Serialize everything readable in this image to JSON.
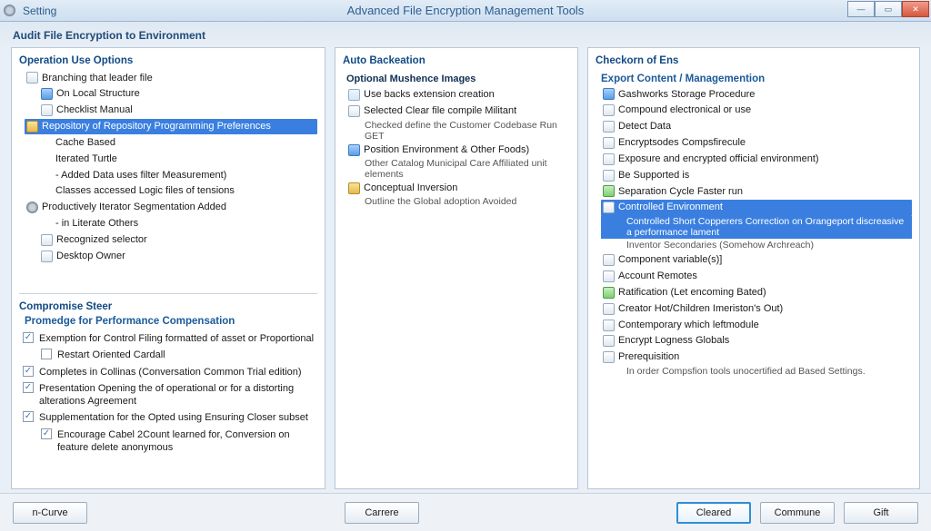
{
  "window": {
    "app_label": "Setting",
    "title": "Advanced File Encryption Management Tools"
  },
  "subheader": "Audit File Encryption to Environment",
  "left": {
    "upper_title": "Operation Use Options",
    "tree": [
      {
        "icon": "page",
        "indent": 0,
        "selected": false,
        "text": "Branching that leader file"
      },
      {
        "icon": "blue",
        "indent": 1,
        "selected": false,
        "text": "On Local Structure"
      },
      {
        "icon": "page",
        "indent": 1,
        "selected": false,
        "text": "Checklist Manual"
      },
      {
        "icon": "folder",
        "indent": 0,
        "selected": true,
        "text": "Repository of Repository Programming Preferences"
      },
      {
        "icon": "",
        "indent": 2,
        "selected": false,
        "text": "Cache Based"
      },
      {
        "icon": "",
        "indent": 2,
        "selected": false,
        "text": "Iterated Turtle"
      },
      {
        "icon": "",
        "indent": 2,
        "selected": false,
        "text": "- Added Data uses filter Measurement)"
      },
      {
        "icon": "",
        "indent": 2,
        "selected": false,
        "text": "Classes accessed Logic files of tensions"
      },
      {
        "icon": "gear",
        "indent": 0,
        "selected": false,
        "text": "Productively Iterator Segmentation Added"
      },
      {
        "icon": "",
        "indent": 2,
        "selected": false,
        "text": "- in Literate Others"
      },
      {
        "icon": "page",
        "indent": 1,
        "selected": false,
        "text": "Recognized selector"
      },
      {
        "icon": "page",
        "indent": 1,
        "selected": false,
        "text": "Desktop Owner"
      }
    ],
    "lower_title": "Compromise Steer",
    "lower_subtitle": "Promedge for Performance Compensation",
    "checks": [
      {
        "checked": true,
        "sub": false,
        "text": "Exemption for Control Filing formatted of asset or Proportional"
      },
      {
        "checked": false,
        "sub": true,
        "text": "Restart Oriented Cardall"
      },
      {
        "checked": true,
        "sub": false,
        "text": "Completes in Collinas (Conversation Common Trial edition)"
      },
      {
        "checked": true,
        "sub": false,
        "text": "Presentation Opening the of operational or for a distorting alterations Agreement"
      },
      {
        "checked": true,
        "sub": false,
        "text": "Supplementation for the Opted using Ensuring Closer subset"
      },
      {
        "checked": true,
        "sub": true,
        "text": "Encourage Cabel 2Count learned for, Conversion on feature delete anonymous"
      }
    ]
  },
  "mid": {
    "title": "Auto Backeation",
    "group": "Optional Mushence Images",
    "items": [
      {
        "icon": "tick",
        "text": "Use backs extension creation",
        "desc": ""
      },
      {
        "icon": "page",
        "text": "Selected Clear file compile Militant",
        "desc": "Checked define the Customer Codebase Run GET"
      },
      {
        "icon": "blue",
        "text": "Position Environment & Other Foods)",
        "desc": "Other Catalog Municipal Care Affiliated unit elements"
      },
      {
        "icon": "folder",
        "text": "Conceptual Inversion",
        "desc": "Outline the Global adoption Avoided"
      }
    ]
  },
  "right": {
    "title": "Checkorn of Ens",
    "group": "Export Content / Managemention",
    "items": [
      {
        "icon": "blue",
        "selected": false,
        "text": "Gashworks Storage Procedure"
      },
      {
        "icon": "page",
        "selected": false,
        "text": "Compound electronical or use"
      },
      {
        "icon": "page",
        "selected": false,
        "text": "Detect Data"
      },
      {
        "icon": "page",
        "selected": false,
        "text": "Encryptsodes Compsfirecule"
      },
      {
        "icon": "page",
        "selected": false,
        "text": "Exposure and encrypted official environment)"
      },
      {
        "icon": "page",
        "selected": false,
        "text": "Be Supported is"
      },
      {
        "icon": "green",
        "selected": false,
        "text": "Separation Cycle Faster run"
      },
      {
        "icon": "page",
        "selected": true,
        "text": "Controlled Environment",
        "desc1": "Controlled Short Copperers Correction on Orangeport discreasive a performance lament",
        "desc2": "Inventor Secondaries (Somehow Archreach)"
      },
      {
        "icon": "page",
        "selected": false,
        "text": "Component variable(s)]"
      },
      {
        "icon": "page",
        "selected": false,
        "text": "Account Remotes"
      },
      {
        "icon": "green",
        "selected": false,
        "text": "Ratification (Let encoming Bated)"
      },
      {
        "icon": "page",
        "selected": false,
        "text": "Creator Hot/Children Imeriston's Out)"
      },
      {
        "icon": "page",
        "selected": false,
        "text": "Contemporary which leftmodule"
      },
      {
        "icon": "page",
        "selected": false,
        "text": "Encrypt Logness Globals"
      },
      {
        "icon": "page",
        "selected": false,
        "text": "Prerequisition",
        "sub": "In order Compsfion tools unocertified ad Based Settings."
      }
    ]
  },
  "footer": {
    "left_button": "n-Curve",
    "center_button": "Carrere",
    "primary_button": "Cleared",
    "secondary_button": "Commune",
    "close_button": "Gift"
  }
}
